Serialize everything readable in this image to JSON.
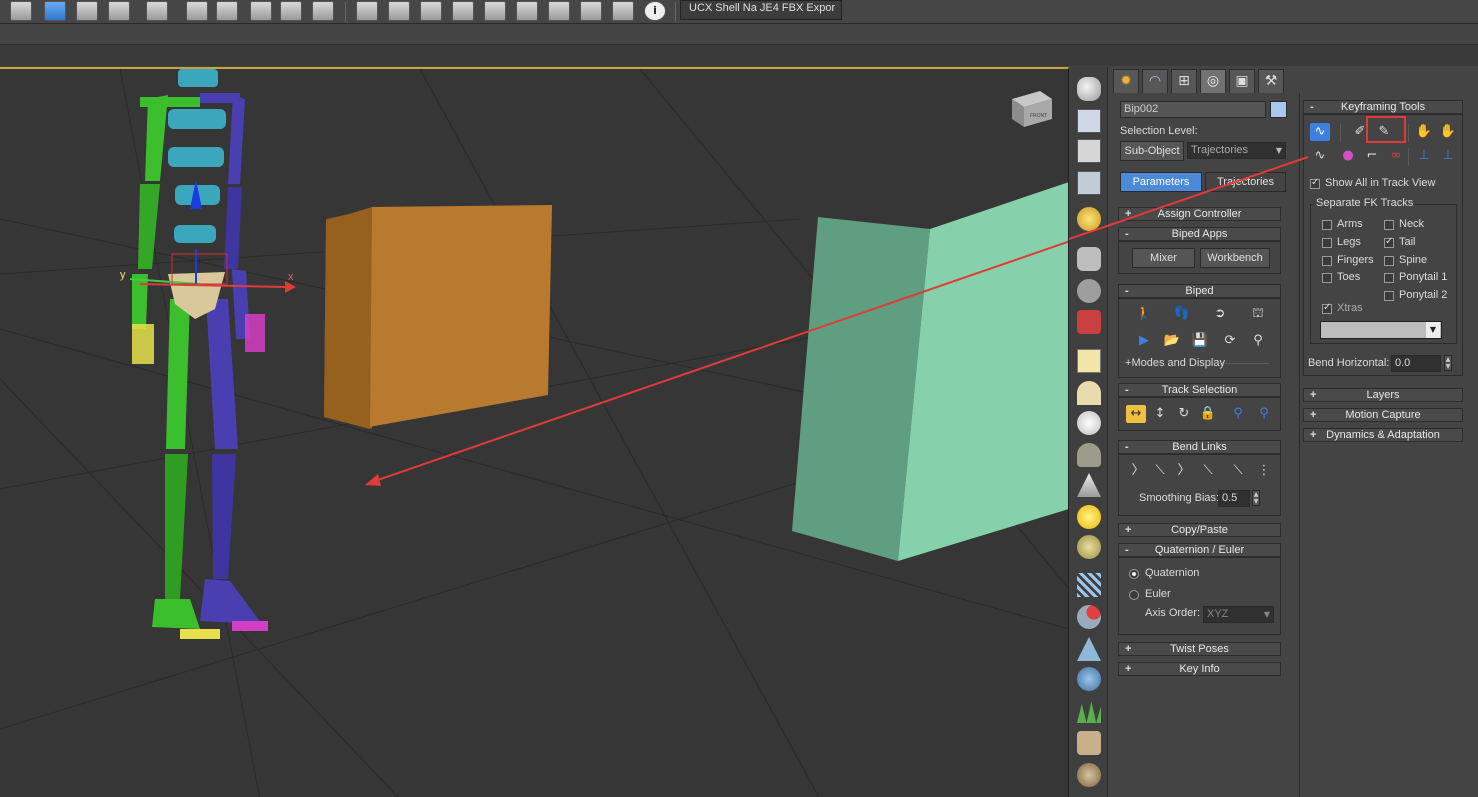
{
  "toolbar": {
    "plugin_label": "UCX Shell Na JE4 FBX Expor",
    "icons": [
      "viewport-layout-icon",
      "selection-filter-icon",
      "curve-editor-icon",
      "schematic-view-icon",
      "layer-explorer-icon",
      "scene-explorer-icon",
      "teapot-render-icon",
      "material-editor-icon",
      "render-frame-icon",
      "create-box-icon",
      "undo-icon",
      "link-icon",
      "save-scene-icon",
      "import-icon",
      "export-icon",
      "export-selected-icon",
      "sync-icon",
      "info-icon"
    ]
  },
  "command_panel": {
    "tabs": [
      "create-tab",
      "modify-tab",
      "hierarchy-tab",
      "motion-tab",
      "display-tab",
      "utilities-tab"
    ],
    "object_name": "Bip002",
    "object_color": "#a8c8f0",
    "selection_level_label": "Selection Level:",
    "subobject_label": "Sub-Object",
    "subobject_dropdown": "Trajectories",
    "parameters_label": "Parameters",
    "trajectories_label": "Trajectories",
    "assign_controller": "Assign Controller",
    "biped_apps": "Biped Apps",
    "mixer": "Mixer",
    "workbench": "Workbench",
    "biped": "Biped",
    "modes_display": "Modes and Display",
    "track_selection": "Track Selection",
    "bend_links": "Bend Links",
    "smoothing_bias_label": "Smoothing Bias:",
    "smoothing_bias_value": "0.5",
    "copy_paste": "Copy/Paste",
    "quaternion_euler": "Quaternion / Euler",
    "quaternion": "Quaternion",
    "euler": "Euler",
    "axis_order_label": "Axis Order:",
    "axis_order_value": "XYZ",
    "twist_poses": "Twist Poses",
    "key_info": "Key Info"
  },
  "keyframing": {
    "title": "Keyframing Tools",
    "show_all_track_view": "Show All in Track View",
    "separate_fk_tracks": "Separate FK Tracks",
    "arms": "Arms",
    "neck": "Neck",
    "legs": "Legs",
    "tail": "Tail",
    "fingers": "Fingers",
    "spine": "Spine",
    "toes": "Toes",
    "ponytail1": "Ponytail 1",
    "ponytail2": "Ponytail 2",
    "xtras": "Xtras",
    "bend_horizontal_label": "Bend Horizontal:",
    "bend_horizontal_value": "0.0",
    "layers": "Layers",
    "motion_capture": "Motion Capture",
    "dynamics": "Dynamics & Adaptation",
    "checked": {
      "show_all": true,
      "arms": false,
      "neck": false,
      "legs": false,
      "tail": true,
      "fingers": false,
      "spine": false,
      "toes": false,
      "ponytail1": false,
      "ponytail2": false,
      "xtras": true
    }
  },
  "viewport": {
    "axis_x": "x",
    "axis_y": "y",
    "viewcube_label": "FRONT",
    "colors": {
      "orange_box": "#b87a2e",
      "mint_box": "#86d1ac",
      "left_arm": "#3cbf2d",
      "right_arm": "#4a3fb0",
      "spine": "#3aa7bd",
      "pelvis": "#d9c89a",
      "arrow": "#e03a3a"
    }
  },
  "create_bar_icons": [
    "teapot-icon",
    "render-setup-icon",
    "list-icon",
    "grid-icon",
    "light-icon",
    "camera-icon",
    "helper-icon",
    "video-icon",
    "plane-icon",
    "dome-icon",
    "sphere-icon",
    "geosphere-icon",
    "cone-icon",
    "sun-icon",
    "disc-icon",
    "particle-icon",
    "bone-icon",
    "pyramid-icon",
    "gear-flower-icon",
    "foliage-icon",
    "hair-icon",
    "fur-icon"
  ]
}
